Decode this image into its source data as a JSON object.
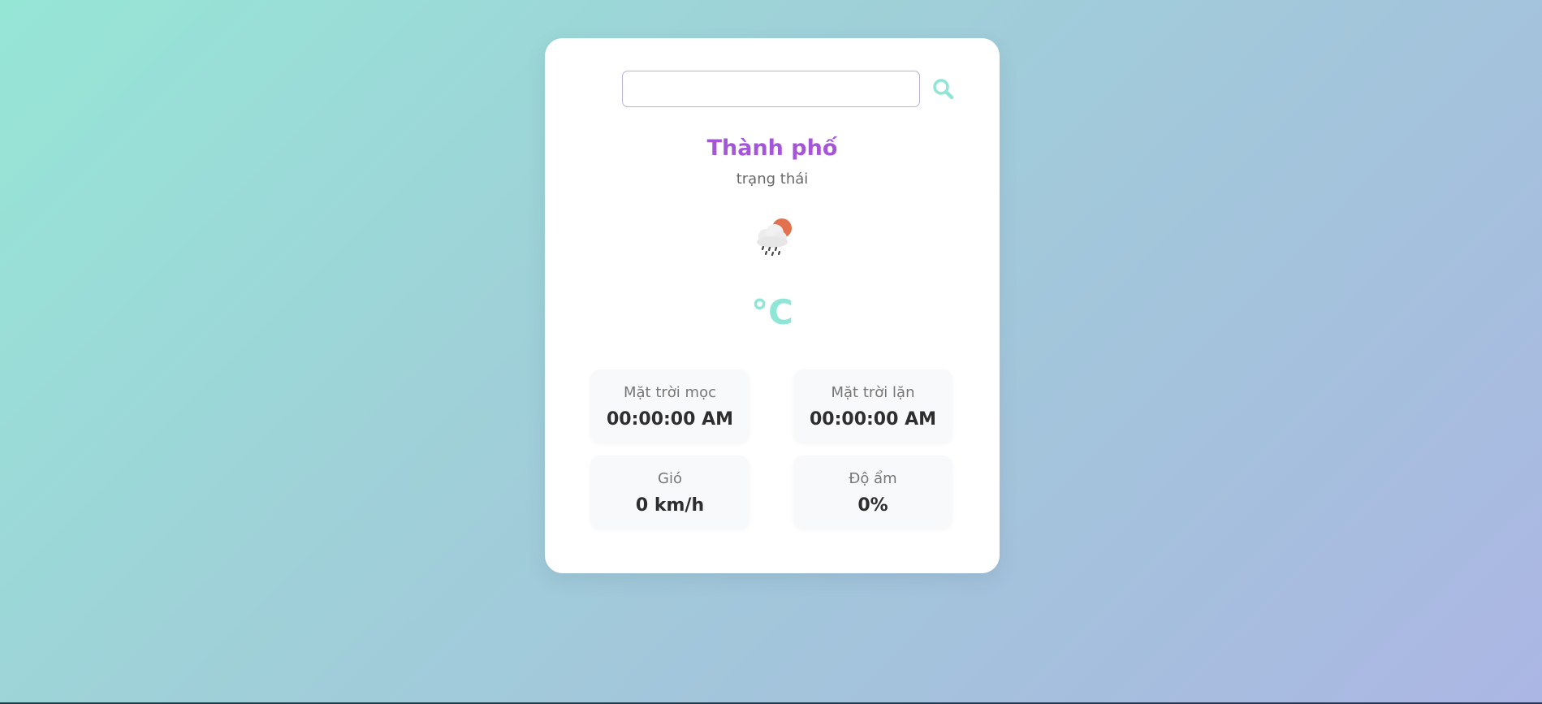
{
  "search": {
    "value": "",
    "placeholder": ""
  },
  "weather": {
    "city": "Thành phố",
    "status": "trạng thái",
    "temperature": "°C",
    "icon": "rain-cloud-sun-icon"
  },
  "details": {
    "sunrise": {
      "label": "Mặt trời mọc",
      "value": "00:00:00 AM"
    },
    "sunset": {
      "label": "Mặt trời lặn",
      "value": "00:00:00 AM"
    },
    "wind": {
      "label": "Gió",
      "value": "0 km/h"
    },
    "humidity": {
      "label": "Độ ẩm",
      "value": "0%"
    }
  },
  "colors": {
    "accent": "#8fe6d6",
    "city": "#a555d8",
    "input_border": "#b9b1d8"
  }
}
